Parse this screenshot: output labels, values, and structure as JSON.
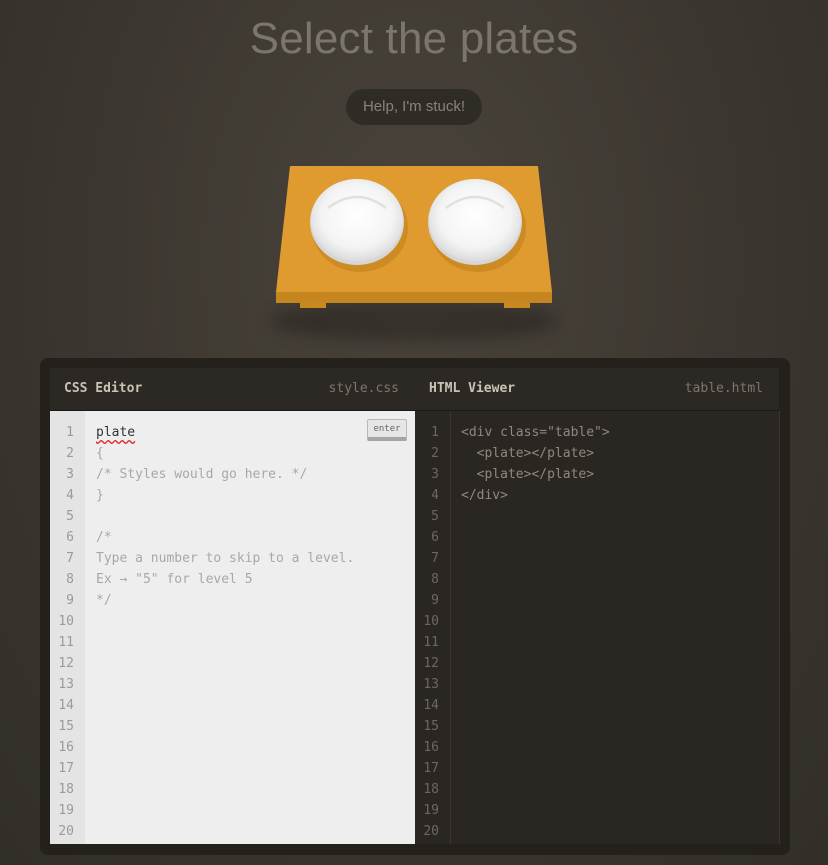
{
  "header": {
    "title": "Select the plates",
    "help_label": "Help, I'm stuck!"
  },
  "scene": {
    "table_color": "#df9b30",
    "plate_count": 2
  },
  "css_editor": {
    "title": "CSS Editor",
    "filename": "style.css",
    "input_value": "plate",
    "enter_label": "enter",
    "lines": [
      "{",
      "/* Styles would go here. */",
      "}",
      "",
      "/*",
      "Type a number to skip to a level.",
      "Ex → \"5\" for level 5",
      "*/"
    ],
    "line_numbers": [
      "1",
      "2",
      "3",
      "4",
      "5",
      "6",
      "7",
      "8",
      "9",
      "10",
      "11",
      "12",
      "13",
      "14",
      "15",
      "16",
      "17",
      "18",
      "19",
      "20"
    ]
  },
  "html_viewer": {
    "title": "HTML Viewer",
    "filename": "table.html",
    "lines": [
      "<div class=\"table\">",
      "  <plate></plate>",
      "  <plate></plate>",
      "</div>"
    ],
    "line_numbers": [
      "1",
      "2",
      "3",
      "4",
      "5",
      "6",
      "7",
      "8",
      "9",
      "10",
      "11",
      "12",
      "13",
      "14",
      "15",
      "16",
      "17",
      "18",
      "19",
      "20"
    ]
  }
}
